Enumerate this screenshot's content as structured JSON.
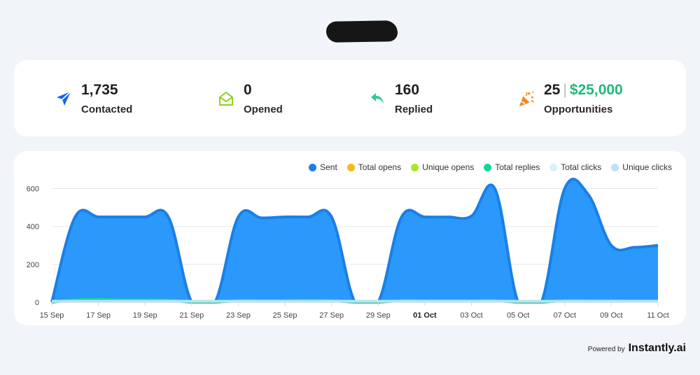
{
  "header": {
    "redacted": true
  },
  "stats": [
    {
      "id": "contacted",
      "value": "1,735",
      "label": "Contacted",
      "icon": "paper-plane-icon",
      "color": "#1565e6"
    },
    {
      "id": "opened",
      "value": "0",
      "label": "Opened",
      "icon": "open-envelope-icon",
      "color": "#8fd11b"
    },
    {
      "id": "replied",
      "value": "160",
      "label": "Replied",
      "icon": "reply-arrow-icon",
      "color": "#2ec99a"
    },
    {
      "id": "opportunities",
      "value": "25",
      "money": "$25,000",
      "label": "Opportunities",
      "icon": "party-popper-icon",
      "color": "#f08b1d"
    }
  ],
  "legend": [
    {
      "name": "Sent",
      "color": "#1a7fe8"
    },
    {
      "name": "Total opens",
      "color": "#f6b919"
    },
    {
      "name": "Unique opens",
      "color": "#a8e825"
    },
    {
      "name": "Total replies",
      "color": "#12d79a"
    },
    {
      "name": "Total clicks",
      "color": "#d6f2fb"
    },
    {
      "name": "Unique clicks",
      "color": "#b8e3f7"
    }
  ],
  "chart_data": {
    "type": "area",
    "x": [
      "15 Sep",
      "16 Sep",
      "17 Sep",
      "18 Sep",
      "19 Sep",
      "20 Sep",
      "21 Sep",
      "22 Sep",
      "23 Sep",
      "24 Sep",
      "25 Sep",
      "26 Sep",
      "27 Sep",
      "28 Sep",
      "29 Sep",
      "30 Sep",
      "01 Oct",
      "02 Oct",
      "03 Oct",
      "04 Oct",
      "05 Oct",
      "06 Oct",
      "07 Oct",
      "08 Oct",
      "09 Oct",
      "10 Oct",
      "11 Oct"
    ],
    "x_tick_labels": [
      "15 Sep",
      "17 Sep",
      "19 Sep",
      "21 Sep",
      "23 Sep",
      "25 Sep",
      "27 Sep",
      "29 Sep",
      "01 Oct",
      "03 Oct",
      "05 Oct",
      "07 Oct",
      "09 Oct",
      "11 Oct"
    ],
    "bold_ticks": [
      "01 Oct"
    ],
    "y_ticks": [
      0,
      200,
      400,
      600
    ],
    "ylim": [
      0,
      650
    ],
    "grid": true,
    "legend_position": "top-right",
    "series": [
      {
        "name": "Sent",
        "color": "#1a7fe8",
        "fill": "#2b99fb",
        "values": [
          0,
          450,
          450,
          450,
          450,
          450,
          0,
          0,
          450,
          445,
          450,
          450,
          450,
          0,
          0,
          450,
          450,
          450,
          455,
          600,
          0,
          0,
          600,
          570,
          300,
          290,
          300
        ]
      },
      {
        "name": "Total replies",
        "color": "#12d79a",
        "fill": "#b8ecd3",
        "values": [
          0,
          12,
          15,
          12,
          12,
          10,
          0,
          0,
          8,
          8,
          8,
          10,
          8,
          0,
          0,
          8,
          8,
          8,
          8,
          8,
          0,
          0,
          8,
          8,
          8,
          6,
          6
        ]
      },
      {
        "name": "Unique clicks",
        "color": "#b8e3f7",
        "fill": "#d3f5d8",
        "values": [
          5,
          5,
          5,
          5,
          5,
          5,
          5,
          5,
          5,
          5,
          5,
          5,
          5,
          5,
          5,
          5,
          5,
          5,
          5,
          5,
          5,
          5,
          5,
          5,
          5,
          5,
          5
        ]
      }
    ]
  },
  "footer": {
    "powered_by": "Powered by",
    "brand": "Instantly.ai"
  }
}
